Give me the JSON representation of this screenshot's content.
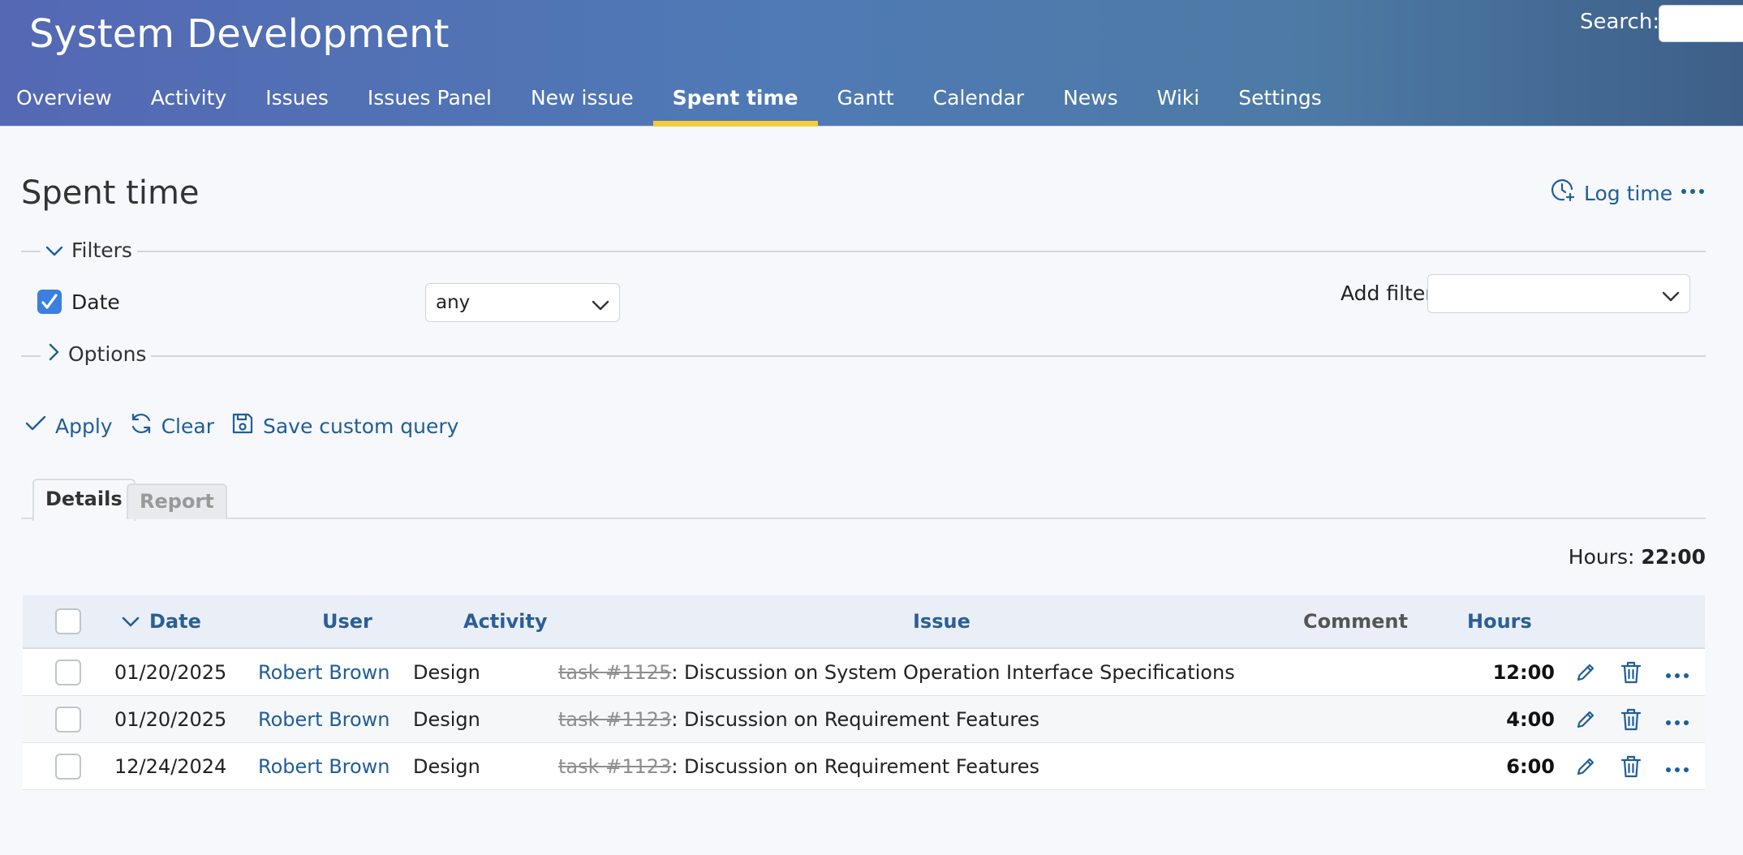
{
  "header": {
    "project_title": "System Development",
    "search_label": "Search:",
    "search_value": ""
  },
  "menu": {
    "items": [
      {
        "label": "Overview"
      },
      {
        "label": "Activity"
      },
      {
        "label": "Issues"
      },
      {
        "label": "Issues Panel"
      },
      {
        "label": "New issue"
      },
      {
        "label": "Spent time",
        "selected": true
      },
      {
        "label": "Gantt"
      },
      {
        "label": "Calendar"
      },
      {
        "label": "News"
      },
      {
        "label": "Wiki"
      },
      {
        "label": "Settings"
      }
    ]
  },
  "page": {
    "title": "Spent time",
    "log_time_label": "Log time"
  },
  "filters": {
    "legend": "Filters",
    "date_label": "Date",
    "date_checked": true,
    "operator_value": "any",
    "add_filter_label": "Add filter",
    "add_filter_value": ""
  },
  "options": {
    "legend": "Options"
  },
  "actions": {
    "apply": "Apply",
    "clear": "Clear",
    "save_query": "Save custom query"
  },
  "tabs": {
    "details": "Details",
    "report": "Report",
    "active": "details"
  },
  "totals": {
    "hours_label": "Hours:",
    "hours_value": "22:00"
  },
  "table": {
    "columns": {
      "date": "Date",
      "user": "User",
      "activity": "Activity",
      "issue": "Issue",
      "comment": "Comment",
      "hours": "Hours"
    },
    "sort": {
      "column": "date",
      "direction": "desc"
    },
    "rows": [
      {
        "date": "01/20/2025",
        "user": "Robert Brown",
        "activity": "Design",
        "issue_ref": "task #1125",
        "issue_subject": ": Discussion on System Operation Interface Specifications",
        "comment": "",
        "hours": "12:00"
      },
      {
        "date": "01/20/2025",
        "user": "Robert Brown",
        "activity": "Design",
        "issue_ref": "task #1123",
        "issue_subject": ": Discussion on Requirement Features",
        "comment": "",
        "hours": "4:00"
      },
      {
        "date": "12/24/2024",
        "user": "Robert Brown",
        "activity": "Design",
        "issue_ref": "task #1123",
        "issue_subject": ": Discussion on Requirement Features",
        "comment": "",
        "hours": "6:00"
      }
    ]
  },
  "colors": {
    "header_start": "#5468b4",
    "header_end": "#3d5f88",
    "menu_selected_underline": "#f5cd3c",
    "link": "#1f5e99",
    "checkbox_checked": "#3b7fe0"
  },
  "icons": {
    "log_time": "clock-plus-icon",
    "more": "ellipsis-icon",
    "filters_toggle": "chevron-down-icon",
    "options_toggle": "chevron-right-icon",
    "apply": "check-icon",
    "clear": "refresh-icon",
    "save": "floppy-disk-icon",
    "edit": "pencil-icon",
    "delete": "trash-icon"
  }
}
